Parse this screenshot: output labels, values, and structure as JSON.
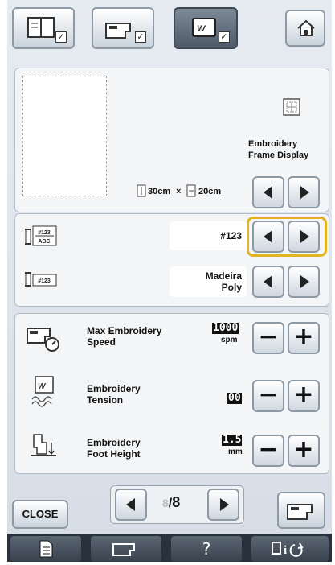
{
  "top_tabs": [
    {
      "name": "settings-page-1-tab"
    },
    {
      "name": "sewing-settings-tab"
    },
    {
      "name": "embroidery-settings-tab",
      "selected": true
    }
  ],
  "frame_display": {
    "label_line1": "Embroidery",
    "label_line2": "Frame Display",
    "width": "30cm",
    "times": "×",
    "height": "20cm"
  },
  "thread_number_display": {
    "value": "#123",
    "icon_top": "#123",
    "icon_bottom": "ABC"
  },
  "thread_brand": {
    "value_line1": "Madeira",
    "value_line2": "Poly",
    "icon_text": "#123"
  },
  "max_speed": {
    "label_line1": "Max Embroidery",
    "label_line2": "Speed",
    "value": "1000",
    "unit": "spm"
  },
  "tension": {
    "label_line1": "Embroidery",
    "label_line2": "Tension",
    "value": "00"
  },
  "foot_height": {
    "label_line1": "Embroidery",
    "label_line2": "Foot Height",
    "value": "1.5",
    "unit": "mm"
  },
  "pager": {
    "current": "8",
    "total": "8"
  },
  "close_label": "CLOSE",
  "bottom_help": "?",
  "highlight_color": "#e3b322"
}
